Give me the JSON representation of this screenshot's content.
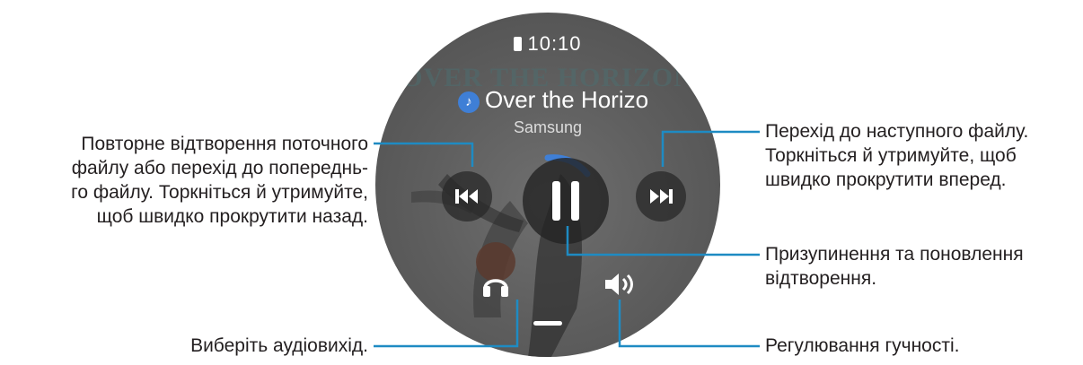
{
  "watch": {
    "status_time": "10:10",
    "background_title": "OVER THE HORIZON",
    "song_title": "Over the Horizo",
    "artist": "Samsung"
  },
  "icons": {
    "battery": "battery-icon",
    "music_note": "music-note-icon",
    "previous": "previous-track-icon",
    "play_pause": "pause-icon",
    "next": "next-track-icon",
    "audio_output": "headphones-icon",
    "volume": "volume-icon"
  },
  "colors": {
    "progress_accent": "#3f7fd6",
    "leader_line": "#1e8bc3"
  },
  "callouts": {
    "previous": [
      "Повторне відтворення поточного",
      "файлу або перехід до попереднь-",
      "го файлу. Торкніться й утримуйте,",
      "щоб швидко прокрутити назад."
    ],
    "audio_output": [
      "Виберіть аудіовихід."
    ],
    "next": [
      "Перехід до наступного файлу.",
      "Торкніться й утримуйте, щоб",
      "швидко прокрутити вперед."
    ],
    "pause": [
      "Призупинення та поновлення",
      "відтворення."
    ],
    "volume": [
      "Регулювання гучності."
    ]
  }
}
